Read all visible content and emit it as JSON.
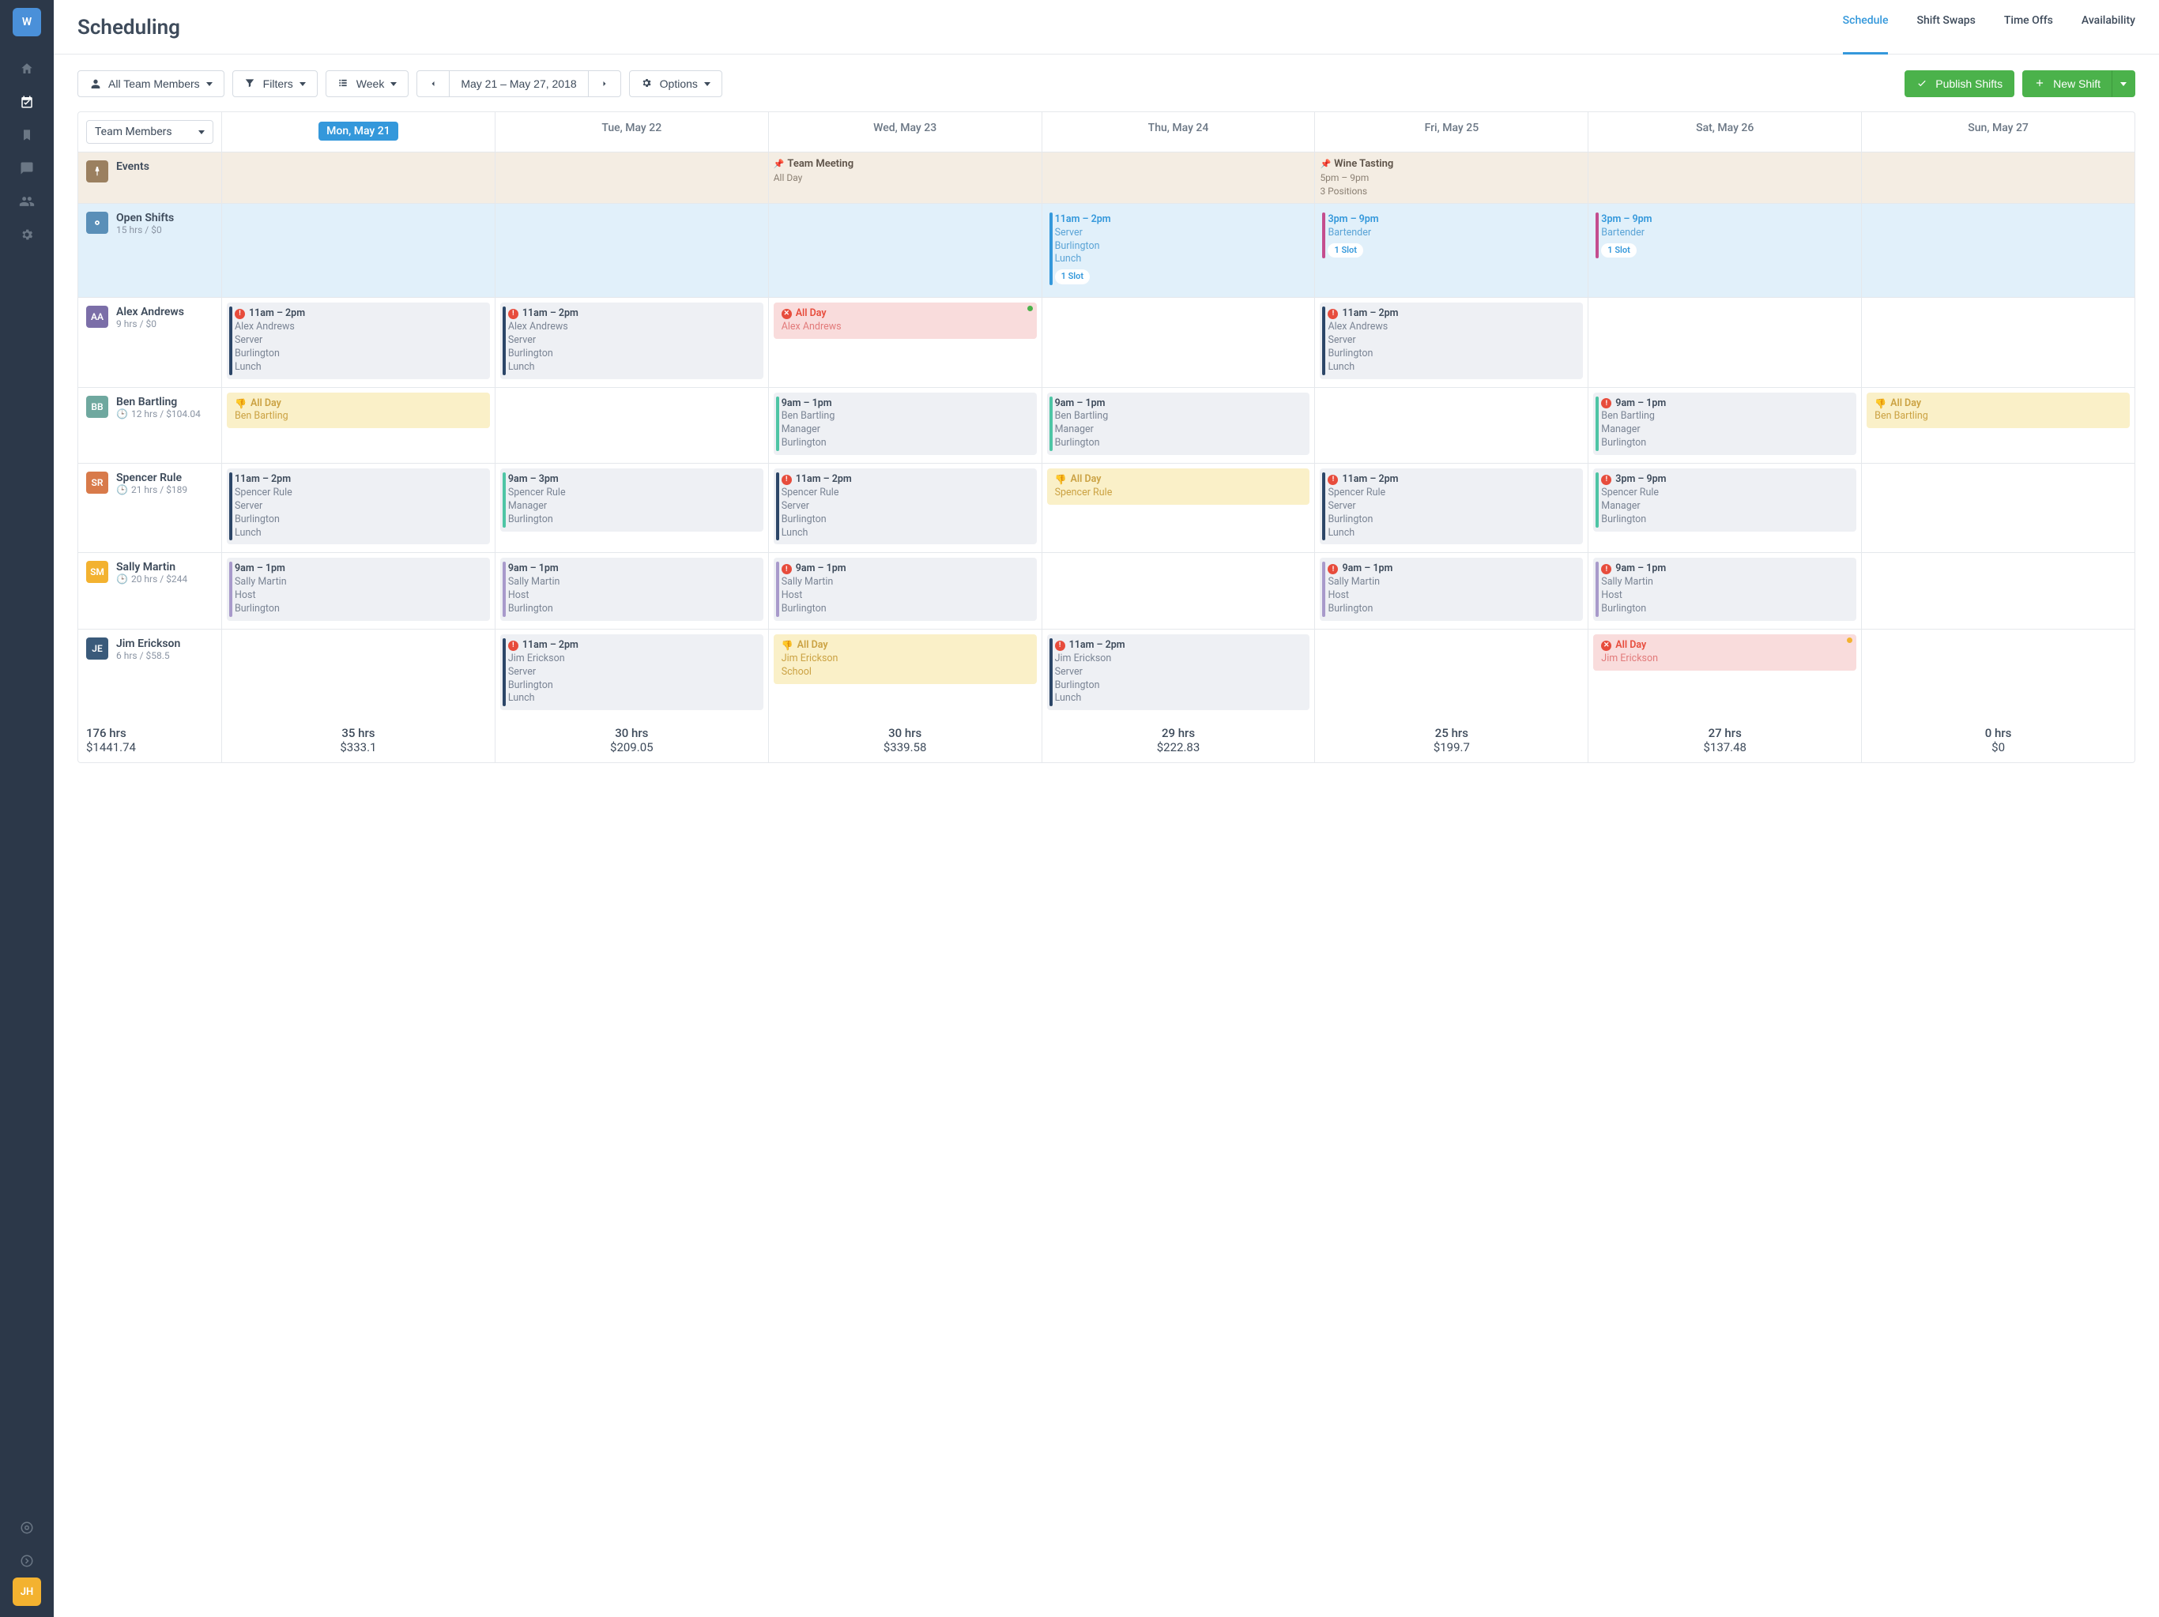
{
  "sidebar": {
    "logo": "W",
    "user_avatar": "JH"
  },
  "header": {
    "title": "Scheduling",
    "tabs": [
      "Schedule",
      "Shift Swaps",
      "Time Offs",
      "Availability"
    ],
    "active_tab": 0
  },
  "toolbar": {
    "team_members": "All Team Members",
    "filters": "Filters",
    "view": "Week",
    "date_range": "May 21 – May 27, 2018",
    "options": "Options",
    "publish": "Publish Shifts",
    "new_shift": "New Shift"
  },
  "grid": {
    "first_col_header": "Team Members",
    "days": [
      "Mon, May 21",
      "Tue, May 22",
      "Wed, May 23",
      "Thu, May 24",
      "Fri, May 25",
      "Sat, May 26",
      "Sun, May 27"
    ],
    "active_day": 0,
    "events_label": "Events",
    "events": {
      "wed": {
        "title": "Team Meeting",
        "sub": "All Day"
      },
      "fri": {
        "title": "Wine Tasting",
        "line1": "5pm – 9pm",
        "line2": "3 Positions"
      }
    },
    "open_shifts": {
      "label": "Open Shifts",
      "sub": "15 hrs / $0",
      "thu": {
        "time": "11am – 2pm",
        "role": "Server",
        "loc": "Burlington",
        "seg": "Lunch",
        "slot": "1 Slot"
      },
      "fri": {
        "time": "3pm – 9pm",
        "role": "Bartender",
        "slot": "1 Slot"
      },
      "sat": {
        "time": "3pm – 9pm",
        "role": "Bartender",
        "slot": "1 Slot"
      }
    },
    "members": [
      {
        "initials": "AA",
        "avclass": "av-purple",
        "name": "Alex Andrews",
        "sub": "9 hrs / $0",
        "clock": false,
        "shifts": {
          "mon": {
            "type": "gray",
            "bar": "bar-navy",
            "warn": true,
            "time": "11am – 2pm",
            "lines": [
              "Alex Andrews",
              "Server",
              "Burlington",
              "Lunch"
            ]
          },
          "tue": {
            "type": "gray",
            "bar": "bar-navy",
            "warn": true,
            "time": "11am – 2pm",
            "lines": [
              "Alex Andrews",
              "Server",
              "Burlington",
              "Lunch"
            ]
          },
          "wed": {
            "type": "red",
            "x": true,
            "dot": "green",
            "time": "All Day",
            "lines": [
              "Alex Andrews"
            ]
          },
          "fri": {
            "type": "gray",
            "bar": "bar-navy",
            "warn": true,
            "time": "11am – 2pm",
            "lines": [
              "Alex Andrews",
              "Server",
              "Burlington",
              "Lunch"
            ]
          }
        }
      },
      {
        "initials": "BB",
        "avclass": "av-teal",
        "name": "Ben Bartling",
        "sub": "12 hrs / $104.04",
        "clock": true,
        "shifts": {
          "mon": {
            "type": "yellow",
            "thumb": true,
            "time": "All Day",
            "lines": [
              "Ben Bartling"
            ]
          },
          "wed": {
            "type": "gray",
            "bar": "bar-teal",
            "time": "9am – 1pm",
            "lines": [
              "Ben Bartling",
              "Manager",
              "Burlington"
            ]
          },
          "thu": {
            "type": "gray",
            "bar": "bar-teal",
            "time": "9am – 1pm",
            "lines": [
              "Ben Bartling",
              "Manager",
              "Burlington"
            ]
          },
          "sat": {
            "type": "gray",
            "bar": "bar-teal",
            "warn": true,
            "time": "9am – 1pm",
            "lines": [
              "Ben Bartling",
              "Manager",
              "Burlington"
            ]
          },
          "sun": {
            "type": "yellow",
            "thumb": true,
            "time": "All Day",
            "lines": [
              "Ben Bartling"
            ]
          }
        }
      },
      {
        "initials": "SR",
        "avclass": "av-orange",
        "name": "Spencer Rule",
        "sub": "21 hrs / $189",
        "clock": true,
        "shifts": {
          "mon": {
            "type": "gray",
            "bar": "bar-navy",
            "time": "11am – 2pm",
            "lines": [
              "Spencer Rule",
              "Server",
              "Burlington",
              "Lunch"
            ]
          },
          "tue": {
            "type": "gray",
            "bar": "bar-teal",
            "time": "9am – 3pm",
            "lines": [
              "Spencer Rule",
              "Manager",
              "Burlington"
            ]
          },
          "wed": {
            "type": "gray",
            "bar": "bar-navy",
            "warn": true,
            "time": "11am – 2pm",
            "lines": [
              "Spencer Rule",
              "Server",
              "Burlington",
              "Lunch"
            ]
          },
          "thu": {
            "type": "yellow",
            "thumb": true,
            "time": "All Day",
            "lines": [
              "Spencer Rule"
            ]
          },
          "fri": {
            "type": "gray",
            "bar": "bar-navy",
            "warn": true,
            "time": "11am – 2pm",
            "lines": [
              "Spencer Rule",
              "Server",
              "Burlington",
              "Lunch"
            ]
          },
          "sat": {
            "type": "gray",
            "bar": "bar-teal",
            "warn": true,
            "time": "3pm – 9pm",
            "lines": [
              "Spencer Rule",
              "Manager",
              "Burlington"
            ]
          }
        }
      },
      {
        "initials": "SM",
        "avclass": "av-yellow",
        "name": "Sally Martin",
        "sub": "20 hrs / $244",
        "clock": true,
        "shifts": {
          "mon": {
            "type": "gray",
            "bar": "bar-lav",
            "time": "9am – 1pm",
            "lines": [
              "Sally Martin",
              "Host",
              "Burlington"
            ]
          },
          "tue": {
            "type": "gray",
            "bar": "bar-lav",
            "time": "9am – 1pm",
            "lines": [
              "Sally Martin",
              "Host",
              "Burlington"
            ]
          },
          "wed": {
            "type": "gray",
            "bar": "bar-lav",
            "warn": true,
            "time": "9am – 1pm",
            "lines": [
              "Sally Martin",
              "Host",
              "Burlington"
            ]
          },
          "fri": {
            "type": "gray",
            "bar": "bar-lav",
            "warn": true,
            "time": "9am – 1pm",
            "lines": [
              "Sally Martin",
              "Host",
              "Burlington"
            ]
          },
          "sat": {
            "type": "gray",
            "bar": "bar-lav",
            "warn": true,
            "time": "9am – 1pm",
            "lines": [
              "Sally Martin",
              "Host",
              "Burlington"
            ]
          }
        }
      },
      {
        "initials": "JE",
        "avclass": "av-navy",
        "name": "Jim Erickson",
        "sub": "6 hrs / $58.5",
        "clock": false,
        "shifts": {
          "tue": {
            "type": "gray",
            "bar": "bar-navy",
            "warn": true,
            "time": "11am – 2pm",
            "lines": [
              "Jim Erickson",
              "Server",
              "Burlington",
              "Lunch"
            ]
          },
          "wed": {
            "type": "yellow",
            "thumb": true,
            "time": "All Day",
            "lines": [
              "Jim Erickson",
              "School"
            ]
          },
          "thu": {
            "type": "gray",
            "bar": "bar-navy",
            "warn": true,
            "time": "11am – 2pm",
            "lines": [
              "Jim Erickson",
              "Server",
              "Burlington",
              "Lunch"
            ]
          },
          "sat": {
            "type": "red",
            "x": true,
            "dot": "yellow",
            "time": "All Day",
            "lines": [
              "Jim Erickson"
            ]
          }
        }
      }
    ],
    "totals": {
      "overall": {
        "hrs": "176 hrs",
        "amt": "$1441.74"
      },
      "days": [
        {
          "hrs": "35 hrs",
          "amt": "$333.1"
        },
        {
          "hrs": "30 hrs",
          "amt": "$209.05"
        },
        {
          "hrs": "30 hrs",
          "amt": "$339.58"
        },
        {
          "hrs": "29 hrs",
          "amt": "$222.83"
        },
        {
          "hrs": "25 hrs",
          "amt": "$199.7"
        },
        {
          "hrs": "27 hrs",
          "amt": "$137.48"
        },
        {
          "hrs": "0 hrs",
          "amt": "$0"
        }
      ]
    }
  }
}
